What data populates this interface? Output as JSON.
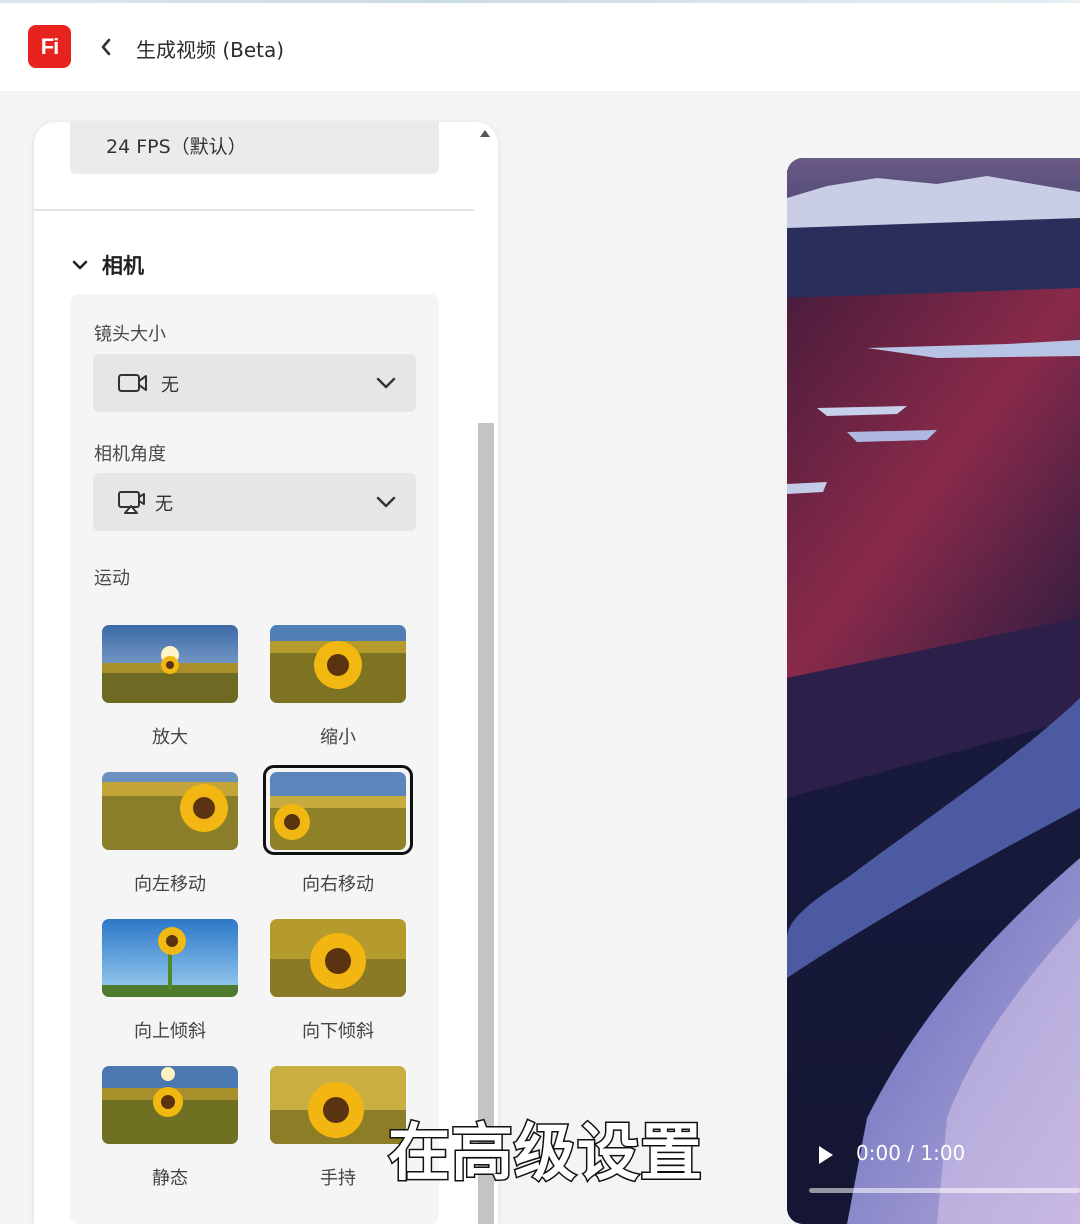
{
  "header": {
    "logo_text": "Fi",
    "title": "生成视频 (Beta)",
    "back_icon": "chevron-left-icon"
  },
  "panel": {
    "fps_value": "24 FPS（默认）",
    "section": {
      "title": "相机",
      "expanded": true,
      "lens_size": {
        "label": "镜头大小",
        "value": "无",
        "icon": "video-camera-icon"
      },
      "camera_angle": {
        "label": "相机角度",
        "value": "无",
        "icon": "camera-angle-icon"
      },
      "motion": {
        "label": "运动",
        "items": [
          {
            "label": "放大",
            "selected": false
          },
          {
            "label": "缩小",
            "selected": false
          },
          {
            "label": "向左移动",
            "selected": false
          },
          {
            "label": "向右移动",
            "selected": true
          },
          {
            "label": "向上倾斜",
            "selected": false
          },
          {
            "label": "向下倾斜",
            "selected": false
          },
          {
            "label": "静态",
            "selected": false
          },
          {
            "label": "手持",
            "selected": false
          }
        ]
      }
    }
  },
  "video": {
    "time": "0:00 / 1:00",
    "progress": 0
  },
  "caption": "在高级设置",
  "colors": {
    "brand": "#e8231e",
    "selected_border": "#111111"
  }
}
